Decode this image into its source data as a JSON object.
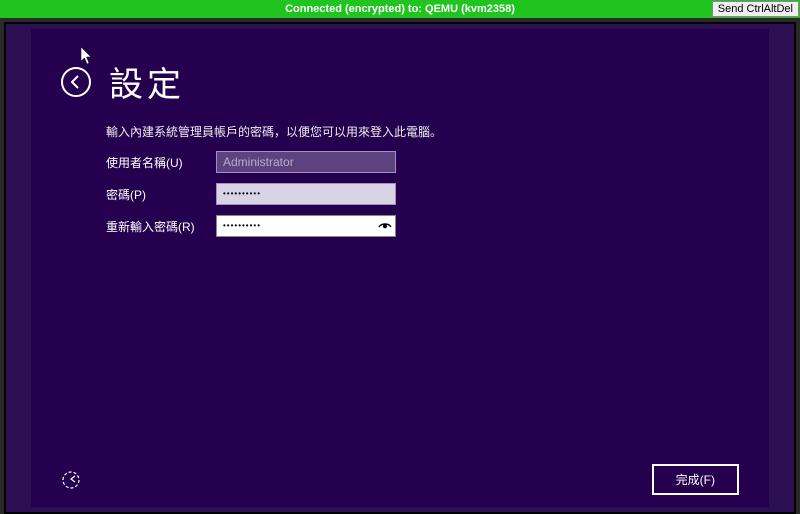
{
  "topbar": {
    "status": "Connected (encrypted) to: QEMU (kvm2358)",
    "send_cad": "Send CtrlAltDel"
  },
  "header": {
    "title": "設定"
  },
  "description": "輸入內建系統管理員帳戶的密碼，以便您可以用來登入此電腦。",
  "form": {
    "username_label": "使用者名稱(U)",
    "username_value": "Administrator",
    "password_label": "密碼(P)",
    "password_mask": "••••••••••",
    "confirm_label": "重新輸入密碼(R)",
    "confirm_mask": "••••••••••"
  },
  "footer": {
    "finish_label": "完成(F)"
  }
}
